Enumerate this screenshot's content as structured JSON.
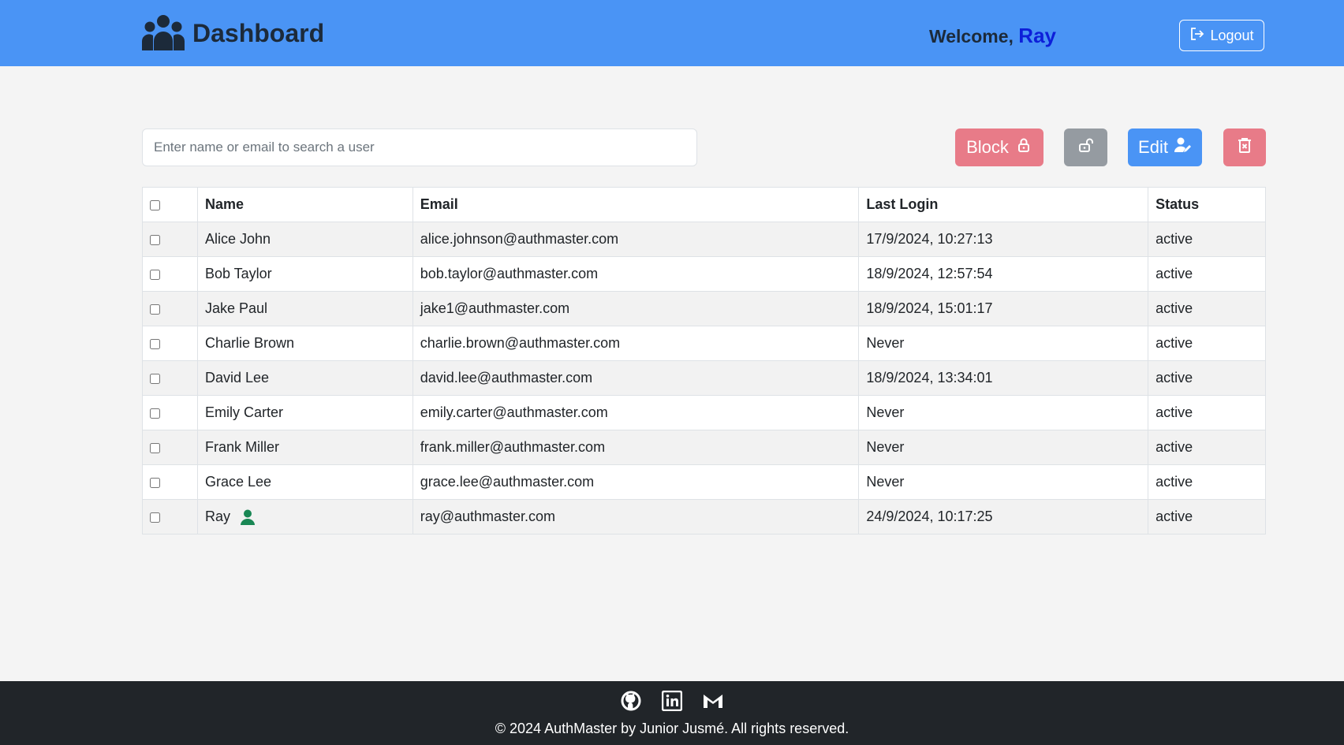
{
  "header": {
    "title": "Dashboard",
    "welcome_label": "Welcome,",
    "user_name": "Ray",
    "logout_label": "Logout",
    "background": "#4a94f5"
  },
  "toolbar": {
    "search_placeholder": "Enter name or email to search a user",
    "block_label": "Block",
    "edit_label": "Edit",
    "icons": {
      "block": "lock-icon",
      "unblock": "unlock-icon",
      "edit": "user-edit-icon",
      "delete": "trash-icon"
    }
  },
  "table": {
    "headers": {
      "name": "Name",
      "email": "Email",
      "last_login": "Last Login",
      "status": "Status"
    },
    "rows": [
      {
        "name": "Alice John",
        "email": "alice.johnson@authmaster.com",
        "last_login": "17/9/2024, 10:27:13",
        "status": "active"
      },
      {
        "name": "Bob Taylor",
        "email": "bob.taylor@authmaster.com",
        "last_login": "18/9/2024, 12:57:54",
        "status": "active"
      },
      {
        "name": "Jake Paul",
        "email": "jake1@authmaster.com",
        "last_login": "18/9/2024, 15:01:17",
        "status": "active"
      },
      {
        "name": "Charlie Brown",
        "email": "charlie.brown@authmaster.com",
        "last_login": "Never",
        "status": "active"
      },
      {
        "name": "David Lee",
        "email": "david.lee@authmaster.com",
        "last_login": "18/9/2024, 13:34:01",
        "status": "active"
      },
      {
        "name": "Emily Carter",
        "email": "emily.carter@authmaster.com",
        "last_login": "Never",
        "status": "active"
      },
      {
        "name": "Frank Miller",
        "email": "frank.miller@authmaster.com",
        "last_login": "Never",
        "status": "active"
      },
      {
        "name": "Grace Lee",
        "email": "grace.lee@authmaster.com",
        "last_login": "Never",
        "status": "active"
      },
      {
        "name": "Ray",
        "email": "ray@authmaster.com",
        "last_login": "24/9/2024, 10:17:25",
        "status": "active"
      }
    ]
  },
  "footer": {
    "copyright": "© 2024 AuthMaster by Junior Jusmé. All rights reserved.",
    "social_icons": [
      "github-icon",
      "linkedin-icon",
      "gmail-icon"
    ]
  }
}
